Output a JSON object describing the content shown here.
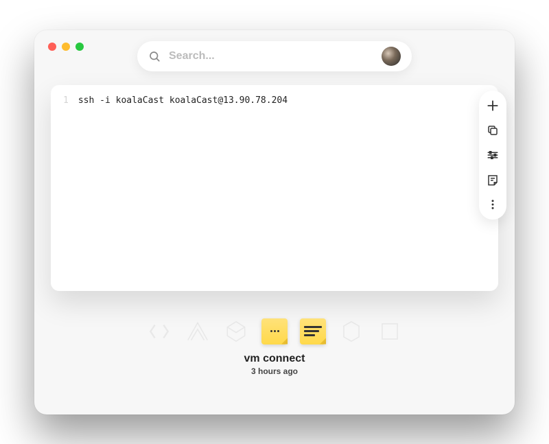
{
  "search": {
    "placeholder": "Search..."
  },
  "snippet": {
    "lines": [
      {
        "n": "1",
        "text": "ssh -i koalaCast koalaCast@13.90.78.204"
      }
    ]
  },
  "item": {
    "title": "vm connect",
    "time": "3 hours ago"
  },
  "toolbar_icons": {
    "add": "add-icon",
    "copy": "copy-icon",
    "tune": "tune-icon",
    "note": "note-icon",
    "more": "more-icon"
  },
  "thumbs": [
    {
      "kind": "faded"
    },
    {
      "kind": "faded"
    },
    {
      "kind": "faded"
    },
    {
      "kind": "sticky-dots"
    },
    {
      "kind": "sticky-lines"
    },
    {
      "kind": "faded"
    },
    {
      "kind": "faded"
    }
  ]
}
